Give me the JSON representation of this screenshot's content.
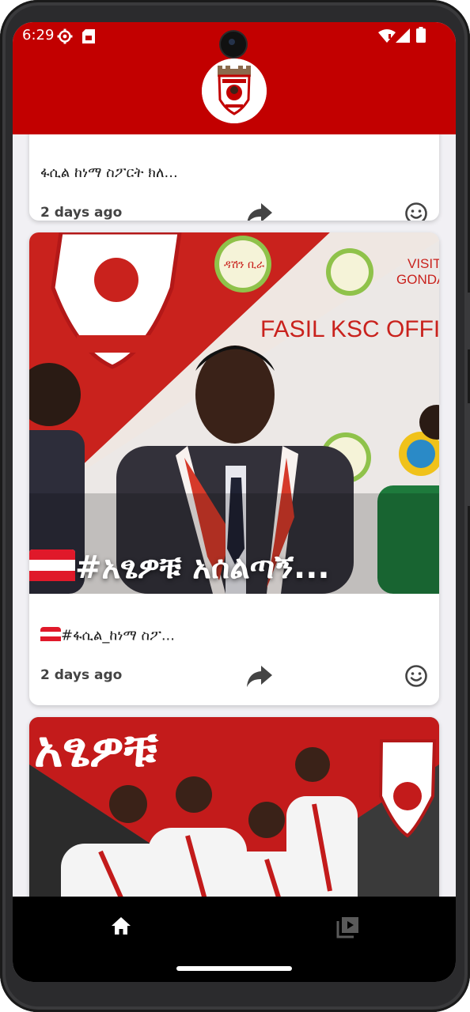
{
  "status_bar": {
    "time": "6:29",
    "icons": [
      "settings-gear-icon",
      "sim-card-icon",
      "wifi-alert-icon",
      "signal-icon",
      "battery-icon"
    ]
  },
  "header": {
    "logo": "fasil-kenema-club-crest",
    "background": "#c20000"
  },
  "feed": {
    "cards": [
      {
        "title": "ፋሲል ከነማ ስፖርት ክለ...",
        "time": "2 days ago",
        "share_icon": "share-arrow-icon",
        "react_icon": "smiley-icon"
      },
      {
        "image_overlay": "#አፄዎቹ አሰልጣኝ...",
        "image_texts": [
          "FASIL KSC OFFI",
          "VISIT",
          "GONDA",
          "ዳሽን ቢራ"
        ],
        "title": "#ፋሲል_ከነማ ስፖ...",
        "time": "2 days ago",
        "share_icon": "share-arrow-icon",
        "react_icon": "smiley-icon"
      },
      {
        "image_overlay": "አፄዎቹ",
        "image_texts": []
      }
    ]
  },
  "bottom_nav": {
    "items": [
      {
        "icon": "home-icon",
        "active": true
      },
      {
        "icon": "video-library-icon",
        "active": false
      }
    ]
  },
  "colors": {
    "brand_red": "#c20000",
    "card_bg": "#ffffff",
    "feed_bg": "#f1f0f4",
    "nav_bg": "#000000"
  }
}
